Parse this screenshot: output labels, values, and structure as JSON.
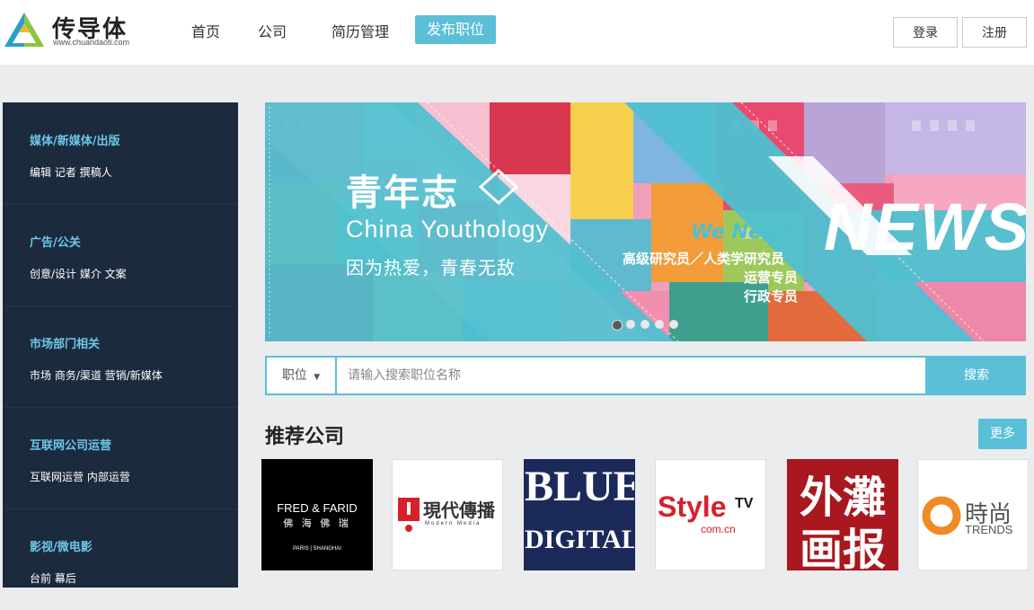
{
  "header": {
    "logo_text": "传导体",
    "logo_sub": "www.chuandaoti.com",
    "nav": [
      "首页",
      "公司",
      "简历管理"
    ],
    "post_job": "发布职位",
    "login": "登录",
    "register": "注册"
  },
  "sidebar": {
    "categories": [
      {
        "title": "媒体/新媒体/出版",
        "sub": "编辑 记者 撰稿人"
      },
      {
        "title": "广告/公关",
        "sub": "创意/设计 媒介 文案"
      },
      {
        "title": "市场部门相关",
        "sub": "市场 商务/渠道 营销/新媒体"
      },
      {
        "title": "互联网公司运营",
        "sub": "互联网运营 内部运营"
      },
      {
        "title": "影视/微电影",
        "sub": "台前 幕后"
      }
    ]
  },
  "banner": {
    "title_cn": "青年志",
    "title_en": "China Youthology",
    "slogan": "因为热爱，青春无敌",
    "we_need": "We Need",
    "news": "NEWS",
    "positions": [
      "高级研究员／人类学研究员",
      "运营专员",
      "行政专员"
    ],
    "slides_total": 5,
    "active_slide": 1
  },
  "search": {
    "type_label": "职位",
    "placeholder": "请输入搜索职位名称",
    "value": "",
    "button": "搜索"
  },
  "companies_section": {
    "title": "推荐公司",
    "more": "更多",
    "logos": [
      {
        "line1": "FRED & FARID",
        "line2": "佛 海 佛 瑞",
        "line3": "PARIS | SHANGHAI"
      },
      {
        "line1": "現代傳播",
        "line2": "Modern Media"
      },
      {
        "line1": "BLUE",
        "line2": "DIGITAL"
      },
      {
        "line1": "Style",
        "line2": "TV",
        "line3": "com.cn"
      },
      {
        "line1": "外灘",
        "line2": "画报"
      },
      {
        "line1": "時尚",
        "line2": "TRENDS"
      }
    ]
  },
  "colors": {
    "accent": "#5bbfd8",
    "sidebar_bg": "#1c2a3e",
    "sidebar_title": "#6cc7e6"
  }
}
